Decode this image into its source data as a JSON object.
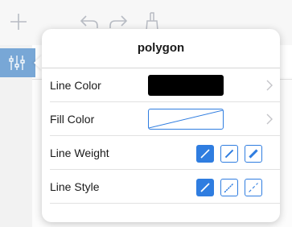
{
  "popover": {
    "title": "polygon",
    "rows": [
      {
        "label": "Line Color",
        "value_color": "#000000"
      },
      {
        "label": "Fill Color",
        "value": "none"
      },
      {
        "label": "Line Weight",
        "selected_index": 0,
        "options": [
          "thin",
          "medium",
          "thick"
        ]
      },
      {
        "label": "Line Style",
        "selected_index": 0,
        "options": [
          "solid",
          "dotted",
          "dashed"
        ]
      }
    ]
  },
  "toolbar": {
    "icons": [
      "plus-icon",
      "undo-icon",
      "redo-icon",
      "tool-icon"
    ]
  },
  "sidebar": {
    "button_icon": "sliders-icon"
  },
  "colors": {
    "accent": "#2f7de0",
    "sidebar_button": "#78a7d6",
    "toolbar_icon": "#b8bcc4"
  }
}
